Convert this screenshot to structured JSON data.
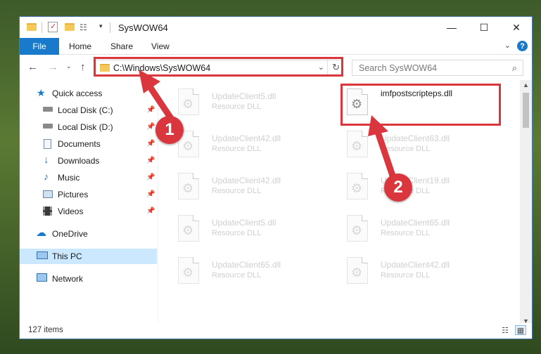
{
  "window": {
    "title": "SysWOW64"
  },
  "titlebar": {
    "minimize": "—",
    "maximize": "☐",
    "close": "✕"
  },
  "ribbon": {
    "file": "File",
    "home": "Home",
    "share": "Share",
    "view": "View",
    "help": "?"
  },
  "nav": {
    "address": "C:\\Windows\\SysWOW64",
    "search_placeholder": "Search SysWOW64"
  },
  "sidebar": {
    "items": [
      {
        "label": "Quick access",
        "icon": "star-icon"
      },
      {
        "label": "Local Disk (C:)",
        "icon": "drive-icon",
        "pinned": true
      },
      {
        "label": "Local Disk (D:)",
        "icon": "drive-icon",
        "pinned": true
      },
      {
        "label": "Documents",
        "icon": "documents-icon",
        "pinned": true
      },
      {
        "label": "Downloads",
        "icon": "downloads-icon",
        "pinned": true
      },
      {
        "label": "Music",
        "icon": "music-icon",
        "pinned": true
      },
      {
        "label": "Pictures",
        "icon": "pictures-icon",
        "pinned": true
      },
      {
        "label": "Videos",
        "icon": "videos-icon",
        "pinned": true
      },
      {
        "label": "OneDrive",
        "icon": "onedrive-icon"
      },
      {
        "label": "This PC",
        "icon": "pc-icon",
        "selected": true
      },
      {
        "label": "Network",
        "icon": "network-icon"
      }
    ]
  },
  "files": [
    {
      "name": "UpdateClient5.dll",
      "type": "Resource DLL"
    },
    {
      "name": "imfpostscripteps.dll",
      "type": ""
    },
    {
      "name": "UpdateClient42.dll",
      "type": "Resource DLL"
    },
    {
      "name": "UpdateClient63.dll",
      "type": "Resource DLL"
    },
    {
      "name": "UpdateClient42.dll",
      "type": "Resource DLL"
    },
    {
      "name": "UpdateClient19.dll",
      "type": "Resource DLL"
    },
    {
      "name": "UpdateClient5.dll",
      "type": "Resource DLL"
    },
    {
      "name": "UpdateClient65.dll",
      "type": "Resource DLL"
    },
    {
      "name": "UpdateClient65.dll",
      "type": "Resource DLL"
    },
    {
      "name": "UpdateClient42.dll",
      "type": "Resource DLL"
    }
  ],
  "status": {
    "count": "127 items"
  },
  "annotations": {
    "step1": "1",
    "step2": "2",
    "color": "#d9363e"
  }
}
